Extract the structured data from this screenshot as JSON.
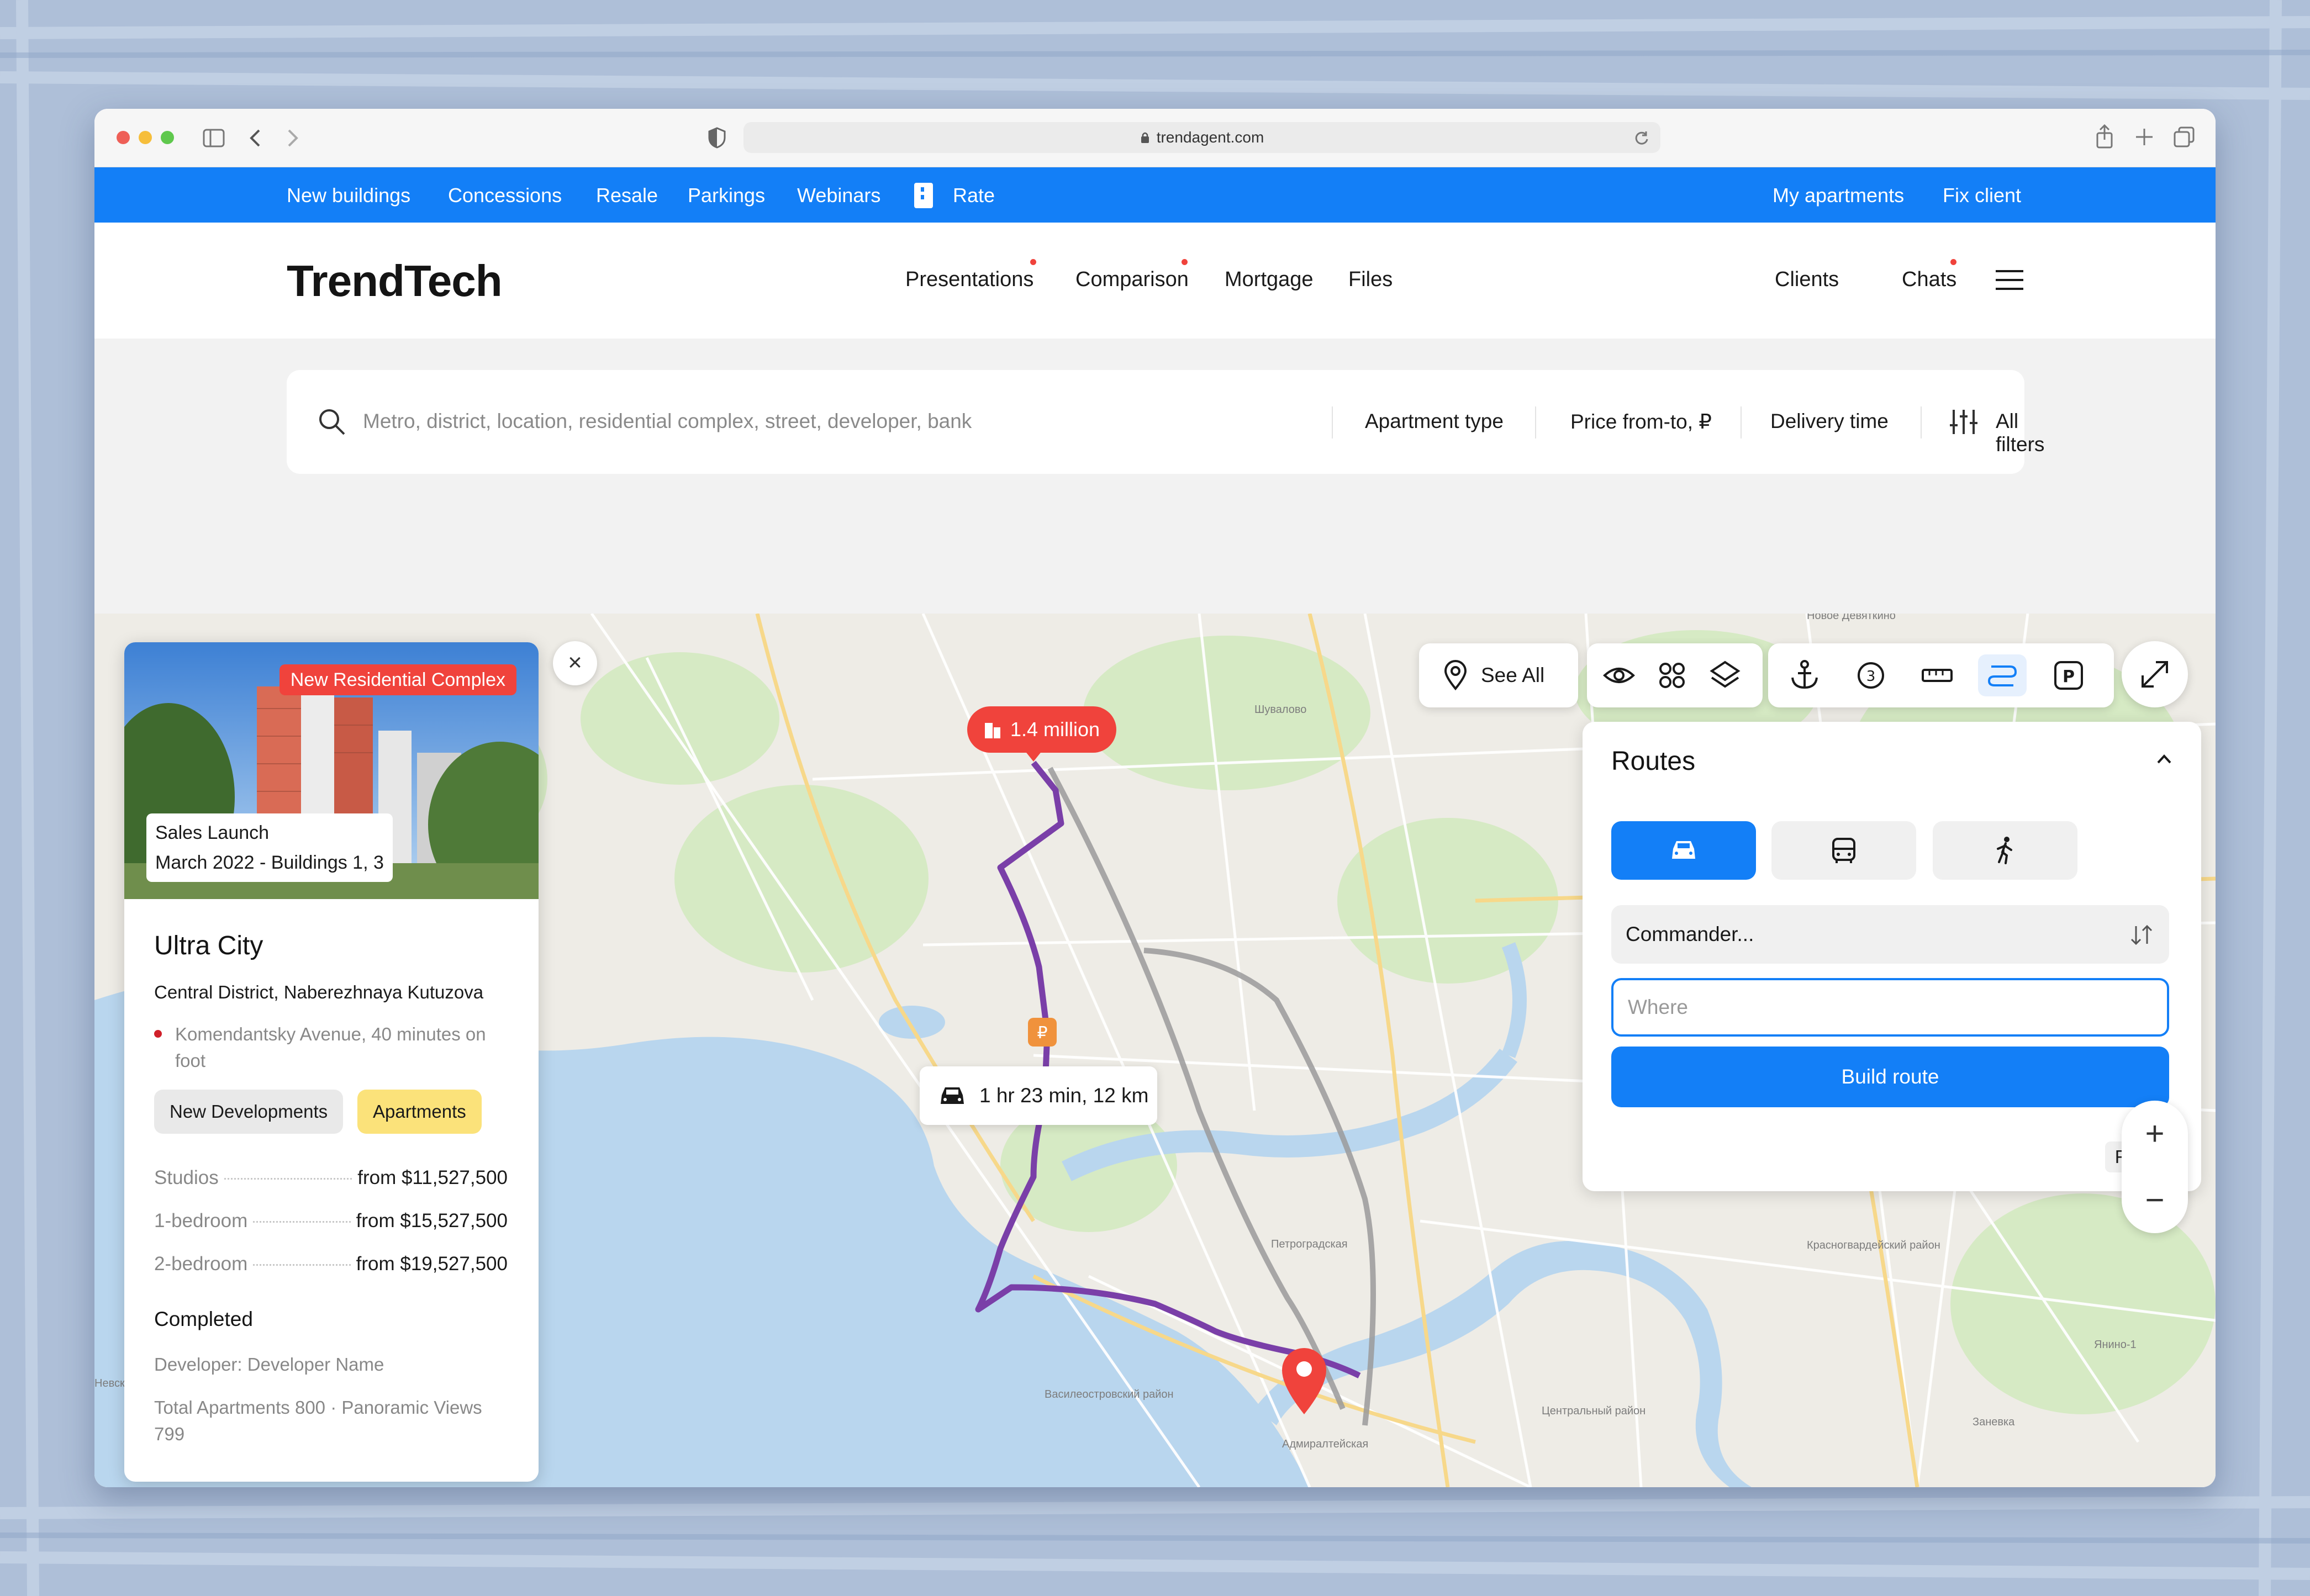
{
  "browser": {
    "url": "trendagent.com"
  },
  "top_nav": {
    "items": [
      "New buildings",
      "Concessions",
      "Resale",
      "Parkings",
      "Webinars",
      "Rate"
    ],
    "right": [
      "My apartments",
      "Fix client"
    ]
  },
  "header": {
    "logo": "TrendTech",
    "nav": [
      "Presentations",
      "Comparison",
      "Mortgage",
      "Files"
    ],
    "right": [
      "Clients",
      "Chats"
    ],
    "menu_icon": "hamburger-icon"
  },
  "search": {
    "placeholder": "Metro, district, location, residential complex, street, developer, bank",
    "filters": {
      "apartment_type": "Apartment type",
      "price": "Price from-to, ₽",
      "delivery": "Delivery time",
      "all": "All filters"
    }
  },
  "listing": {
    "badge": "New Residential Complex",
    "launch_line1": "Sales Launch",
    "launch_line2": "March 2022 - Buildings 1, 3",
    "title": "Ultra City",
    "address": "Central District, Naberezhnaya Kutuzova",
    "metro": "Komendantsky Avenue, 40 minutes on foot",
    "tags": [
      "New Developments",
      "Apartments"
    ],
    "prices": [
      {
        "type": "Studios",
        "price": "from $11,527,500"
      },
      {
        "type": "1-bedroom",
        "price": "from $15,527,500"
      },
      {
        "type": "2-bedroom",
        "price": "from $19,527,500"
      }
    ],
    "status": "Completed",
    "developer": "Developer: Developer Name",
    "stats": "Total Apartments 800 · Panoramic Views 799"
  },
  "map": {
    "price_pin": "1.4 million",
    "route_info": "1 hr 23 min, 12 km",
    "see_all": "See All",
    "labels": [
      "Новое Девяткино",
      "Петроградская",
      "Василеостровский район",
      "Адмиралтейская",
      "Центральный район",
      "Шувалово",
      "Красногвардейский район",
      "Янино-1",
      "Заневка",
      "Невская"
    ],
    "colors": {
      "route": "#7a3fa8",
      "route_alt": "#9a9a9a",
      "water": "#b9d6ee",
      "park": "#d8ecc4",
      "pin": "#f0433c"
    }
  },
  "routes_panel": {
    "title": "Routes",
    "modes": [
      "car-icon",
      "bus-icon",
      "walk-icon"
    ],
    "from_value": "Commander...",
    "to_placeholder": "Where",
    "build": "Build route",
    "reset": "Reset"
  },
  "zoom": {
    "in": "+",
    "out": "−"
  },
  "theme": {
    "accent": "#137ff7",
    "danger": "#f0433c",
    "tag_yellow": "#fbe27a"
  }
}
